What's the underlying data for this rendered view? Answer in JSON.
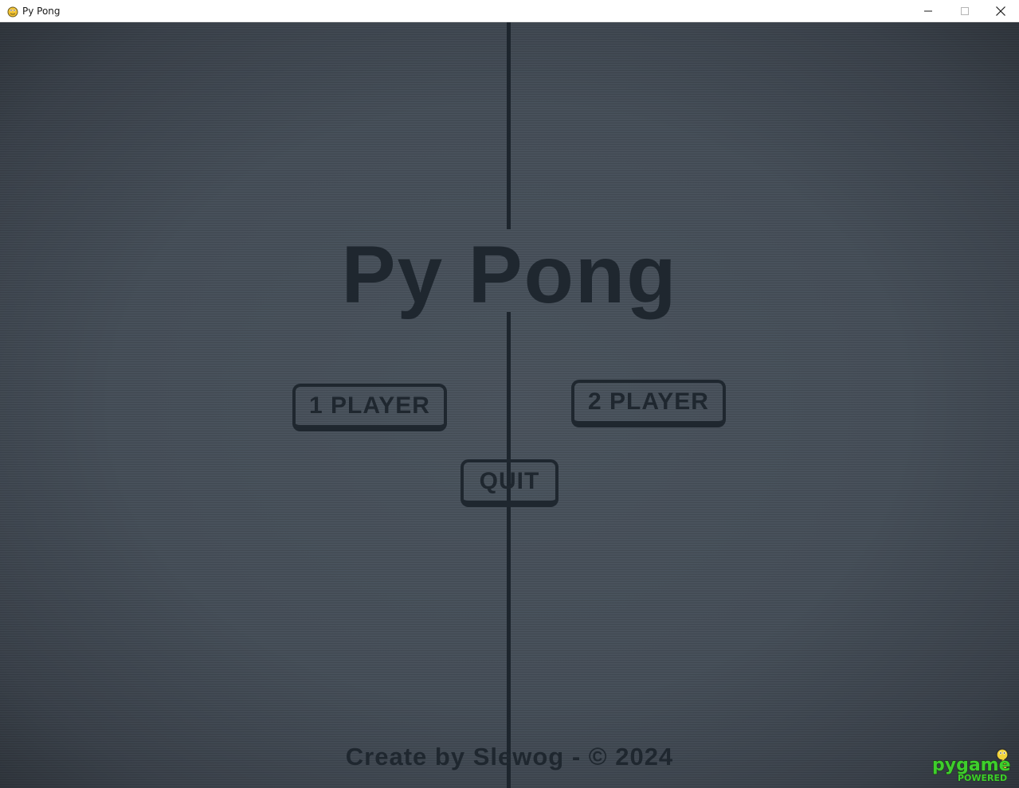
{
  "window": {
    "title": "Py Pong",
    "icon": "pygame-snake-icon"
  },
  "titlebar_controls": {
    "minimize": "minimize-icon",
    "maximize": "maximize-icon",
    "close": "close-icon"
  },
  "game": {
    "title": "Py Pong",
    "buttons": {
      "one_player": "1 PLAYER",
      "two_player": "2 PLAYER",
      "quit": "QUIT"
    },
    "footer": "Create by Slewog - © 2024",
    "logo": {
      "line1": "pygame",
      "line2": "POWERED"
    }
  },
  "colors": {
    "background": "#4a525c",
    "foreground": "#1f272f",
    "logo_green": "#3ecf2c",
    "logo_yellow": "#f2d33a"
  }
}
